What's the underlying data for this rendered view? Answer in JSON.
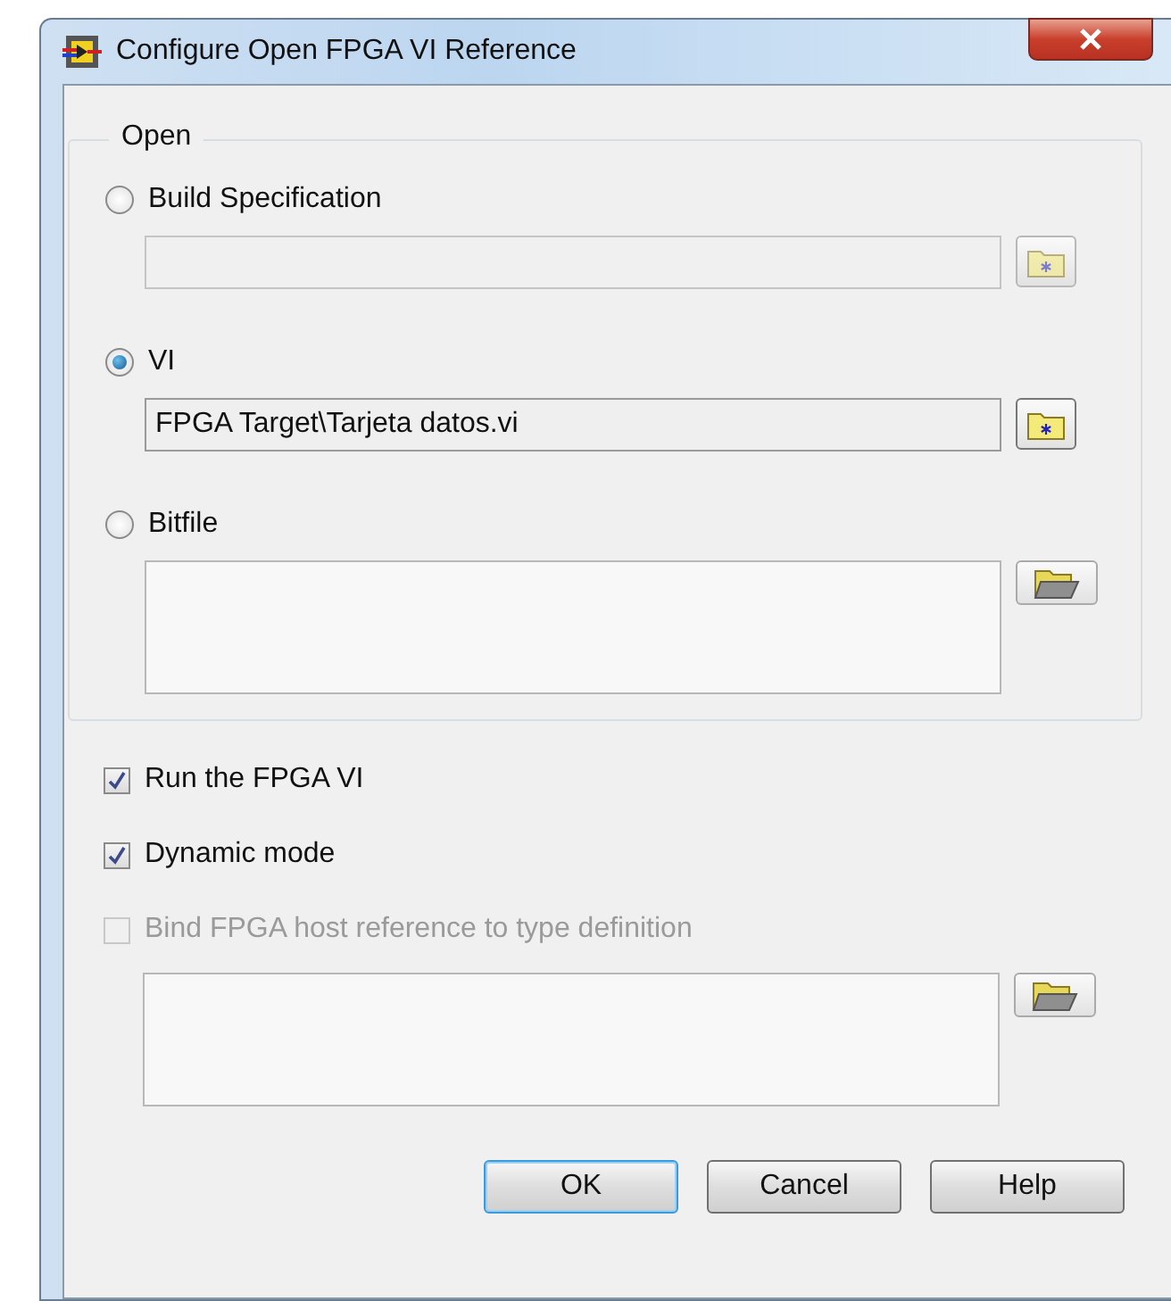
{
  "window": {
    "title": "Configure Open FPGA VI Reference"
  },
  "open_group": {
    "title": "Open",
    "options": [
      {
        "label": "Build Specification",
        "selected": false,
        "field": {
          "kind": "single-line",
          "disabled": true
        }
      },
      {
        "label": "VI",
        "selected": true,
        "field": {
          "kind": "single-line",
          "disabled": false,
          "value": "FPGA Target\\Tarjeta datos.vi"
        }
      },
      {
        "label": "Bitfile",
        "selected": false,
        "field": {
          "kind": "multi-line"
        }
      }
    ]
  },
  "options": [
    {
      "label": "Run the FPGA VI",
      "checked": true,
      "disabled": false
    },
    {
      "label": "Dynamic mode",
      "checked": true,
      "disabled": false
    },
    {
      "label": "Bind FPGA host reference to type definition",
      "checked": false,
      "disabled": true
    }
  ],
  "type_definition_field": {
    "kind": "multi-line"
  },
  "buttons": [
    {
      "label": "OK",
      "default": true
    },
    {
      "label": "Cancel",
      "default": false
    },
    {
      "label": "Help",
      "default": false
    }
  ]
}
